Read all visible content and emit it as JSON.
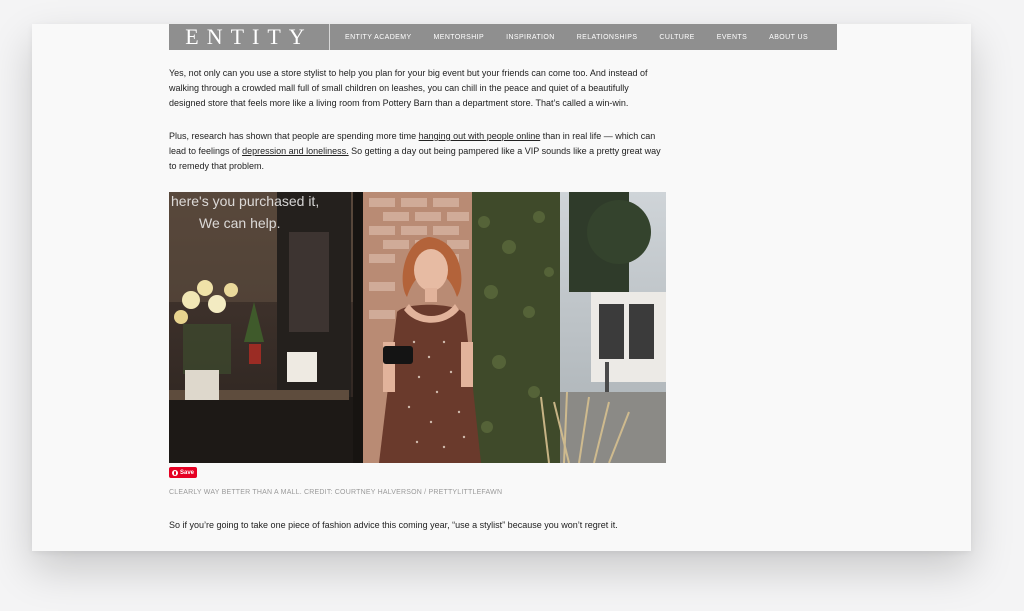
{
  "site": {
    "logo": "ENTITY",
    "nav": [
      "ENTITY ACADEMY",
      "MENTORSHIP",
      "INSPIRATION",
      "RELATIONSHIPS",
      "CULTURE",
      "EVENTS",
      "ABOUT US"
    ]
  },
  "article": {
    "para1": "Yes, not only can you use a store stylist to help you plan for your big event but your friends can come too. And instead of walking through a crowded mall full of small children on leashes, you can chill in the peace and quiet of a beautifully designed store that feels more like a living room from Pottery Barn than a department store. That’s called a win-win.",
    "para2_a": "Plus, research has shown that people are spending more time ",
    "para2_link1": "hanging out with people online",
    "para2_b": " than in real life — which can lead to feelings of ",
    "para2_link2": "depression and loneliness.",
    "para2_c": " So getting a day out being pampered like a VIP sounds like a pretty great way to remedy that problem.",
    "image_overlay_text_1": "here's you purchased it,",
    "image_overlay_text_2": "We can help.",
    "save_label": "Save",
    "caption": "CLEARLY WAY BETTER THAN A MALL. CREDIT: COURTNEY HALVERSON / PRETTYLITTLEFAWN",
    "para3": "So if you’re going to take one piece of fashion advice this coming year, “use a stylist” because you won’t regret it."
  },
  "colors": {
    "nav_bg": "#8f8f8f",
    "save_red": "#e60023",
    "logo_accent": "#c7a56a"
  }
}
